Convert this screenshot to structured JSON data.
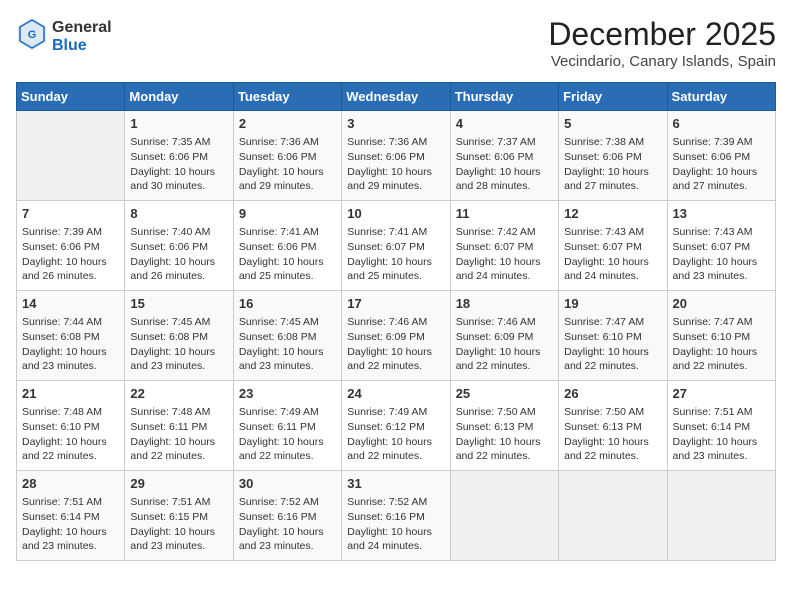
{
  "logo": {
    "general": "General",
    "blue": "Blue"
  },
  "title": "December 2025",
  "location": "Vecindario, Canary Islands, Spain",
  "days_of_week": [
    "Sunday",
    "Monday",
    "Tuesday",
    "Wednesday",
    "Thursday",
    "Friday",
    "Saturday"
  ],
  "weeks": [
    [
      {
        "day": "",
        "info": ""
      },
      {
        "day": "1",
        "info": "Sunrise: 7:35 AM\nSunset: 6:06 PM\nDaylight: 10 hours\nand 30 minutes."
      },
      {
        "day": "2",
        "info": "Sunrise: 7:36 AM\nSunset: 6:06 PM\nDaylight: 10 hours\nand 29 minutes."
      },
      {
        "day": "3",
        "info": "Sunrise: 7:36 AM\nSunset: 6:06 PM\nDaylight: 10 hours\nand 29 minutes."
      },
      {
        "day": "4",
        "info": "Sunrise: 7:37 AM\nSunset: 6:06 PM\nDaylight: 10 hours\nand 28 minutes."
      },
      {
        "day": "5",
        "info": "Sunrise: 7:38 AM\nSunset: 6:06 PM\nDaylight: 10 hours\nand 27 minutes."
      },
      {
        "day": "6",
        "info": "Sunrise: 7:39 AM\nSunset: 6:06 PM\nDaylight: 10 hours\nand 27 minutes."
      }
    ],
    [
      {
        "day": "7",
        "info": "Sunrise: 7:39 AM\nSunset: 6:06 PM\nDaylight: 10 hours\nand 26 minutes."
      },
      {
        "day": "8",
        "info": "Sunrise: 7:40 AM\nSunset: 6:06 PM\nDaylight: 10 hours\nand 26 minutes."
      },
      {
        "day": "9",
        "info": "Sunrise: 7:41 AM\nSunset: 6:06 PM\nDaylight: 10 hours\nand 25 minutes."
      },
      {
        "day": "10",
        "info": "Sunrise: 7:41 AM\nSunset: 6:07 PM\nDaylight: 10 hours\nand 25 minutes."
      },
      {
        "day": "11",
        "info": "Sunrise: 7:42 AM\nSunset: 6:07 PM\nDaylight: 10 hours\nand 24 minutes."
      },
      {
        "day": "12",
        "info": "Sunrise: 7:43 AM\nSunset: 6:07 PM\nDaylight: 10 hours\nand 24 minutes."
      },
      {
        "day": "13",
        "info": "Sunrise: 7:43 AM\nSunset: 6:07 PM\nDaylight: 10 hours\nand 23 minutes."
      }
    ],
    [
      {
        "day": "14",
        "info": "Sunrise: 7:44 AM\nSunset: 6:08 PM\nDaylight: 10 hours\nand 23 minutes."
      },
      {
        "day": "15",
        "info": "Sunrise: 7:45 AM\nSunset: 6:08 PM\nDaylight: 10 hours\nand 23 minutes."
      },
      {
        "day": "16",
        "info": "Sunrise: 7:45 AM\nSunset: 6:08 PM\nDaylight: 10 hours\nand 23 minutes."
      },
      {
        "day": "17",
        "info": "Sunrise: 7:46 AM\nSunset: 6:09 PM\nDaylight: 10 hours\nand 22 minutes."
      },
      {
        "day": "18",
        "info": "Sunrise: 7:46 AM\nSunset: 6:09 PM\nDaylight: 10 hours\nand 22 minutes."
      },
      {
        "day": "19",
        "info": "Sunrise: 7:47 AM\nSunset: 6:10 PM\nDaylight: 10 hours\nand 22 minutes."
      },
      {
        "day": "20",
        "info": "Sunrise: 7:47 AM\nSunset: 6:10 PM\nDaylight: 10 hours\nand 22 minutes."
      }
    ],
    [
      {
        "day": "21",
        "info": "Sunrise: 7:48 AM\nSunset: 6:10 PM\nDaylight: 10 hours\nand 22 minutes."
      },
      {
        "day": "22",
        "info": "Sunrise: 7:48 AM\nSunset: 6:11 PM\nDaylight: 10 hours\nand 22 minutes."
      },
      {
        "day": "23",
        "info": "Sunrise: 7:49 AM\nSunset: 6:11 PM\nDaylight: 10 hours\nand 22 minutes."
      },
      {
        "day": "24",
        "info": "Sunrise: 7:49 AM\nSunset: 6:12 PM\nDaylight: 10 hours\nand 22 minutes."
      },
      {
        "day": "25",
        "info": "Sunrise: 7:50 AM\nSunset: 6:13 PM\nDaylight: 10 hours\nand 22 minutes."
      },
      {
        "day": "26",
        "info": "Sunrise: 7:50 AM\nSunset: 6:13 PM\nDaylight: 10 hours\nand 22 minutes."
      },
      {
        "day": "27",
        "info": "Sunrise: 7:51 AM\nSunset: 6:14 PM\nDaylight: 10 hours\nand 23 minutes."
      }
    ],
    [
      {
        "day": "28",
        "info": "Sunrise: 7:51 AM\nSunset: 6:14 PM\nDaylight: 10 hours\nand 23 minutes."
      },
      {
        "day": "29",
        "info": "Sunrise: 7:51 AM\nSunset: 6:15 PM\nDaylight: 10 hours\nand 23 minutes."
      },
      {
        "day": "30",
        "info": "Sunrise: 7:52 AM\nSunset: 6:16 PM\nDaylight: 10 hours\nand 23 minutes."
      },
      {
        "day": "31",
        "info": "Sunrise: 7:52 AM\nSunset: 6:16 PM\nDaylight: 10 hours\nand 24 minutes."
      },
      {
        "day": "",
        "info": ""
      },
      {
        "day": "",
        "info": ""
      },
      {
        "day": "",
        "info": ""
      }
    ]
  ]
}
